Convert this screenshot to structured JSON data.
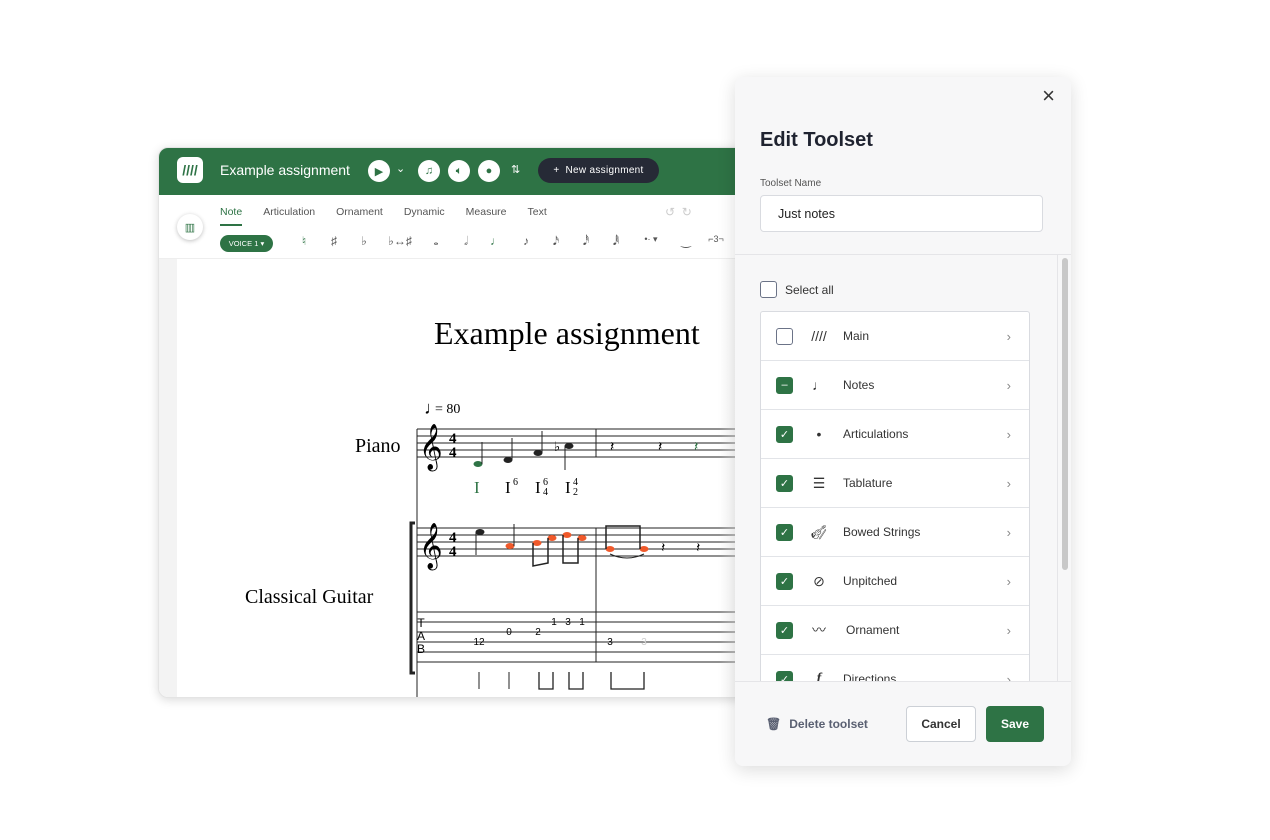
{
  "app": {
    "title": "Example assignment",
    "new_assignment": "New assignment",
    "voice": "VOICE 1 ▾",
    "tabs": [
      "Note",
      "Articulation",
      "Ornament",
      "Dynamic",
      "Measure",
      "Text"
    ],
    "tools": [
      "♮",
      "♯",
      "♭",
      "♭↔♯",
      "𝅝",
      "𝅗𝅥",
      "♩",
      "♪",
      "𝅘𝅥𝅯",
      "𝅘𝅥𝅰",
      "𝅘𝅥𝅱",
      "•· ▾",
      "‿",
      "⌐3¬"
    ]
  },
  "score": {
    "title": "Example assignment",
    "tempo": "= 80",
    "instruments": [
      "Piano",
      "Classical Guitar"
    ],
    "roman": [
      "I",
      "I",
      "I",
      "I"
    ],
    "tab_numbers": [
      "12",
      "0",
      "2",
      "1",
      "3",
      "1",
      "3",
      "3"
    ],
    "colors": {
      "green": "#2e7345",
      "orange": "#f0592a"
    }
  },
  "panel": {
    "title": "Edit Toolset",
    "name_label": "Toolset Name",
    "name_value": "Just notes",
    "select_all": "Select all",
    "items": [
      {
        "label": "Main",
        "icon": "logo-icon",
        "state": "unchecked"
      },
      {
        "label": "Notes",
        "icon": "quarter-note-icon",
        "state": "indeterminate"
      },
      {
        "label": "Articulations",
        "icon": "staccato-icon",
        "state": "checked"
      },
      {
        "label": "Tablature",
        "icon": "tablature-icon",
        "state": "checked"
      },
      {
        "label": "Bowed Strings",
        "icon": "violin-icon",
        "state": "checked"
      },
      {
        "label": "Unpitched",
        "icon": "drum-icon",
        "state": "checked"
      },
      {
        "label": "Ornament",
        "icon": "trill-icon",
        "state": "checked"
      },
      {
        "label": "Directions",
        "icon": "forte-icon",
        "state": "checked"
      }
    ],
    "delete": "Delete toolset",
    "cancel": "Cancel",
    "save": "Save"
  },
  "accent": "#2e7345"
}
